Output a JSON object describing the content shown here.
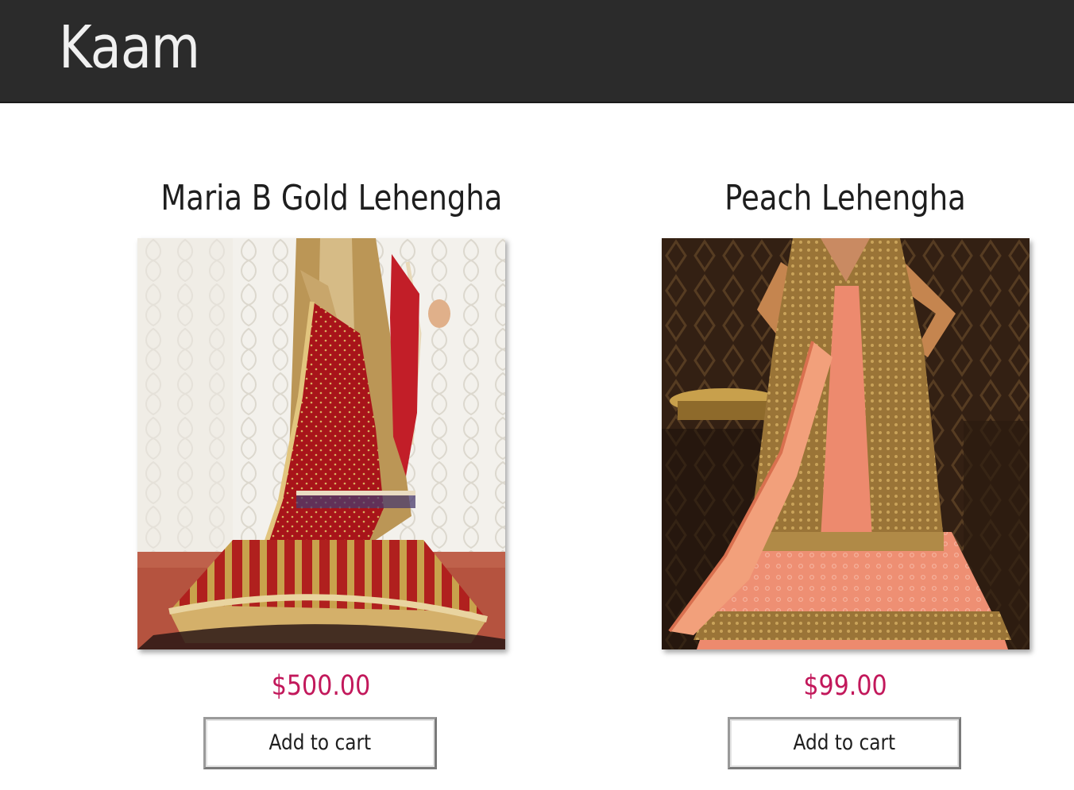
{
  "header": {
    "brand": "Kaam",
    "background_color": "#2b2b2b",
    "brand_color": "#f0f0f0"
  },
  "products": [
    {
      "title": "Maria B Gold Lehengha",
      "image_alt": "Maria B Gold Lehengha",
      "price": "$500.00",
      "add_to_cart_label": "Add to cart"
    },
    {
      "title": "Peach Lehengha",
      "image_alt": "Peach Lehengha",
      "price": "$99.00",
      "add_to_cart_label": "Add to cart"
    }
  ],
  "colors": {
    "price": "#c2185b",
    "text": "#1e1e1e"
  }
}
